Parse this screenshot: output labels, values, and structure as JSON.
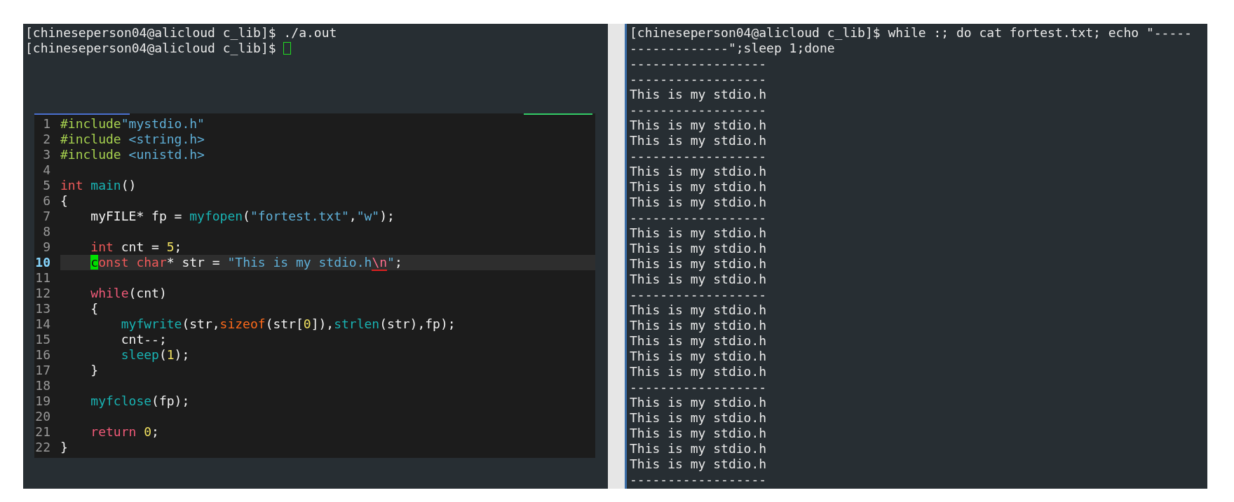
{
  "left_terminal": {
    "lines": [
      {
        "text": "[chineseperson04@alicloud c_lib]$ ./a.out"
      },
      {
        "text": "[chineseperson04@alicloud c_lib]$ "
      }
    ]
  },
  "editor": {
    "lines": [
      {
        "number": "1",
        "current": false,
        "tokens": [
          {
            "kind": "preproc",
            "text": "#include"
          },
          {
            "kind": "string",
            "text": "\"mystdio.h\""
          }
        ]
      },
      {
        "number": "2",
        "current": false,
        "tokens": [
          {
            "kind": "preproc",
            "text": "#include"
          },
          {
            "kind": "string",
            "text": " <string.h>"
          }
        ]
      },
      {
        "number": "3",
        "current": false,
        "tokens": [
          {
            "kind": "preproc",
            "text": "#include"
          },
          {
            "kind": "string",
            "text": " <unistd.h>"
          }
        ]
      },
      {
        "number": "4",
        "current": false
      },
      {
        "number": "5",
        "current": false,
        "tokens": [
          {
            "kind": "type",
            "text": "int"
          },
          {
            "kind": "func",
            "text": " main"
          },
          {
            "kind": "plain",
            "text": "()"
          }
        ]
      },
      {
        "number": "6",
        "current": false,
        "tokens": [
          {
            "kind": "plain",
            "text": "{"
          }
        ]
      },
      {
        "number": "7",
        "current": false,
        "tokens": [
          {
            "kind": "plain",
            "text": "    myFILE* fp = "
          },
          {
            "kind": "func",
            "text": "myfopen"
          },
          {
            "kind": "plain",
            "text": "("
          },
          {
            "kind": "string",
            "text": "\"fortest.txt\""
          },
          {
            "kind": "plain",
            "text": ","
          },
          {
            "kind": "string",
            "text": "\"w\""
          },
          {
            "kind": "plain",
            "text": ");"
          }
        ]
      },
      {
        "number": "8",
        "current": false
      },
      {
        "number": "9",
        "current": false,
        "tokens": [
          {
            "kind": "type",
            "text": "    int"
          },
          {
            "kind": "plain",
            "text": " cnt = "
          },
          {
            "kind": "number",
            "text": "5"
          },
          {
            "kind": "plain",
            "text": ";"
          }
        ]
      },
      {
        "number": "10",
        "current": true,
        "tokens": [
          {
            "kind": "cursor",
            "text": "    c"
          },
          {
            "kind": "type",
            "text": "onst"
          },
          {
            "kind": "type",
            "text": " char"
          },
          {
            "kind": "plain",
            "text": "* str = "
          },
          {
            "kind": "string",
            "text": "\"This is my stdio.h"
          },
          {
            "kind": "escape",
            "text": "\\n"
          },
          {
            "kind": "string",
            "text": "\""
          },
          {
            "kind": "plain",
            "text": ";"
          }
        ]
      },
      {
        "number": "11",
        "current": false
      },
      {
        "number": "12",
        "current": false,
        "tokens": [
          {
            "kind": "keyword",
            "text": "    while"
          },
          {
            "kind": "plain",
            "text": "(cnt)"
          }
        ]
      },
      {
        "number": "13",
        "current": false,
        "tokens": [
          {
            "kind": "plain",
            "text": "    {"
          }
        ]
      },
      {
        "number": "14",
        "current": false,
        "tokens": [
          {
            "kind": "func",
            "text": "        myfwrite"
          },
          {
            "kind": "plain",
            "text": "(str,"
          },
          {
            "kind": "operator",
            "text": "sizeof"
          },
          {
            "kind": "plain",
            "text": "(str["
          },
          {
            "kind": "number",
            "text": "0"
          },
          {
            "kind": "plain",
            "text": "]),"
          },
          {
            "kind": "func",
            "text": "strlen"
          },
          {
            "kind": "plain",
            "text": "(str),fp);"
          }
        ]
      },
      {
        "number": "15",
        "current": false,
        "tokens": [
          {
            "kind": "plain",
            "text": "        cnt--;"
          }
        ]
      },
      {
        "number": "16",
        "current": false,
        "tokens": [
          {
            "kind": "func",
            "text": "        sleep"
          },
          {
            "kind": "plain",
            "text": "("
          },
          {
            "kind": "number",
            "text": "1"
          },
          {
            "kind": "plain",
            "text": ");"
          }
        ]
      },
      {
        "number": "17",
        "current": false,
        "tokens": [
          {
            "kind": "plain",
            "text": "    }"
          }
        ]
      },
      {
        "number": "18",
        "current": false
      },
      {
        "number": "19",
        "current": false,
        "tokens": [
          {
            "kind": "func",
            "text": "    myfclose"
          },
          {
            "kind": "plain",
            "text": "(fp);"
          }
        ]
      },
      {
        "number": "20",
        "current": false
      },
      {
        "number": "21",
        "current": false,
        "tokens": [
          {
            "kind": "keyword",
            "text": "    return"
          },
          {
            "kind": "number",
            "text": " 0"
          },
          {
            "kind": "plain",
            "text": ";"
          }
        ]
      },
      {
        "number": "22",
        "current": false,
        "tokens": [
          {
            "kind": "plain",
            "text": "}"
          }
        ]
      }
    ]
  },
  "right_terminal": {
    "lines": [
      "[chineseperson04@alicloud c_lib]$ while :; do cat fortest.txt; echo \"-----",
      "-------------\";sleep 1;done",
      "------------------",
      "------------------",
      "This is my stdio.h",
      "------------------",
      "This is my stdio.h",
      "This is my stdio.h",
      "------------------",
      "This is my stdio.h",
      "This is my stdio.h",
      "This is my stdio.h",
      "------------------",
      "This is my stdio.h",
      "This is my stdio.h",
      "This is my stdio.h",
      "This is my stdio.h",
      "------------------",
      "This is my stdio.h",
      "This is my stdio.h",
      "This is my stdio.h",
      "This is my stdio.h",
      "This is my stdio.h",
      "------------------",
      "This is my stdio.h",
      "This is my stdio.h",
      "This is my stdio.h",
      "This is my stdio.h",
      "This is my stdio.h",
      "------------------"
    ]
  }
}
